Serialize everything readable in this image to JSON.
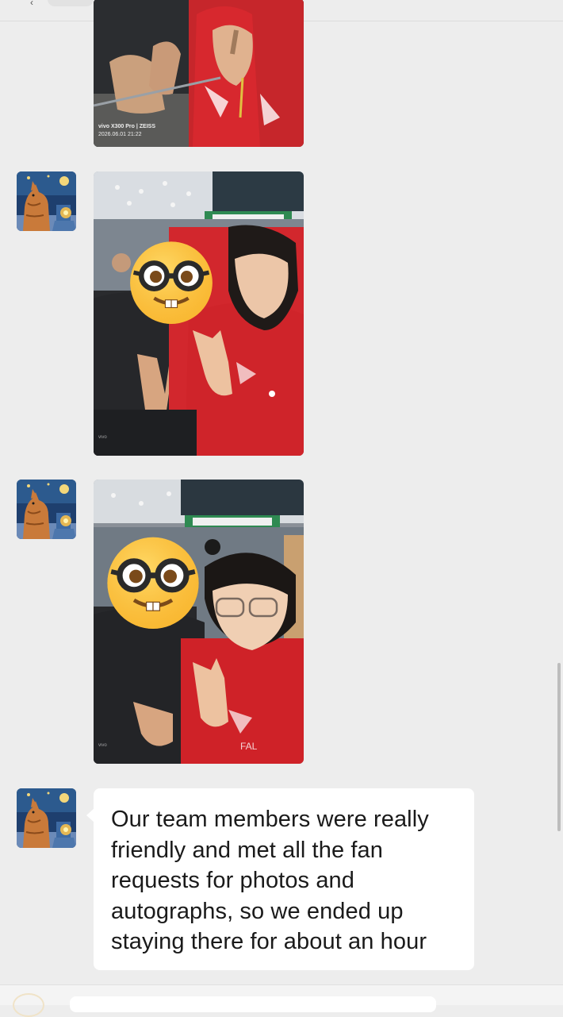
{
  "chat": {
    "messages": [
      {
        "type": "image",
        "sender": "cat-avatar",
        "watermark": {
          "brand": "vivo X300 Pro | ZEISS",
          "datetime": "2026.06.01 21:22"
        }
      },
      {
        "type": "image",
        "sender": "cat-avatar"
      },
      {
        "type": "image",
        "sender": "cat-avatar"
      },
      {
        "type": "text",
        "sender": "cat-avatar",
        "text": "Our team members were really friendly and met all the fan requests for photos and autographs, so we ended up staying there for about an hour"
      }
    ]
  },
  "icons": {
    "avatar": "cat-painting-avatar",
    "face_cover": "nerd-face-emoji",
    "back": "chevron-left-icon"
  },
  "colors": {
    "background": "#ededed",
    "bubble": "#ffffff",
    "jersey_red": "#d8262c",
    "emoji_yellow": "#ffc83d"
  }
}
